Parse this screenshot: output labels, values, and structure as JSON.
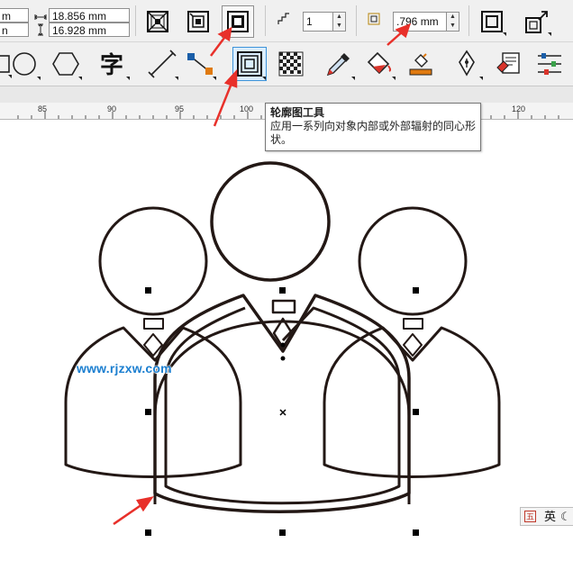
{
  "property_bar": {
    "partial_left_top": "m",
    "partial_left_bottom": "n",
    "width_value": "18.856 mm",
    "height_value": "16.928 mm",
    "steps_value": "1",
    "offset_value": ".796 mm"
  },
  "ruler": {
    "ticks": [
      "85",
      "90",
      "95",
      "100",
      "120"
    ]
  },
  "tooltip": {
    "title": "轮廓图工具",
    "description": "应用一系列向对象内部或外部辐射的同心形状。"
  },
  "watermark": "www.rjzxw.com",
  "ime": {
    "label": "英",
    "logo": "五",
    "moon": "☾"
  },
  "colors": {
    "accent_arrow": "#e8302a",
    "active_border": "#3d93d9",
    "drawing_stroke": "#231815"
  }
}
